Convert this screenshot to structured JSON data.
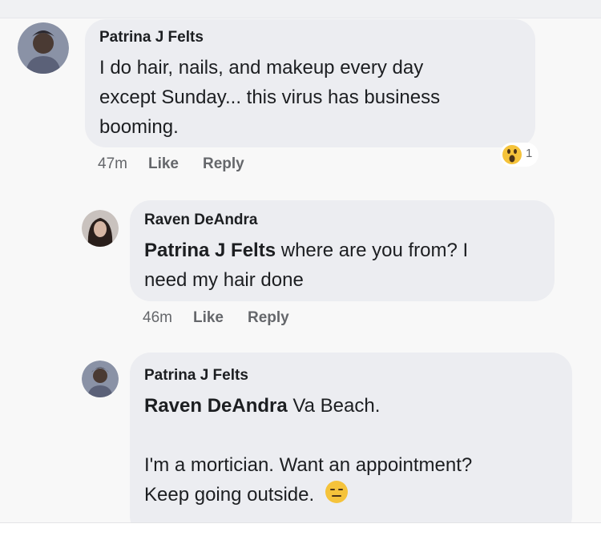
{
  "comments": [
    {
      "author": "Patrina J Felts",
      "lines": [
        "I do hair, nails, and makeup every day",
        "except Sunday... this virus has business",
        "booming."
      ],
      "time": "47m",
      "like_label": "Like",
      "reply_label": "Reply",
      "reaction_count": "1"
    },
    {
      "author": "Raven DeAndra",
      "mention": "Patrina J Felts",
      "line1_rest": " where are you from? I",
      "line2": "need my hair done",
      "time": "46m",
      "like_label": "Like",
      "reply_label": "Reply"
    },
    {
      "author": "Patrina J Felts",
      "mention": "Raven DeAndra",
      "line1_rest": " Va Beach.",
      "line2": "I'm a mortician. Want an appointment?",
      "line3": "Keep going outside."
    }
  ],
  "colors": {
    "bubble": "#ecedf1",
    "meta": "#65676b",
    "reaction_yellow": "#f5c33b"
  },
  "icons": [
    "avatar-patrina",
    "avatar-raven",
    "wow-reaction-icon",
    "expressionless-emoji-icon"
  ]
}
